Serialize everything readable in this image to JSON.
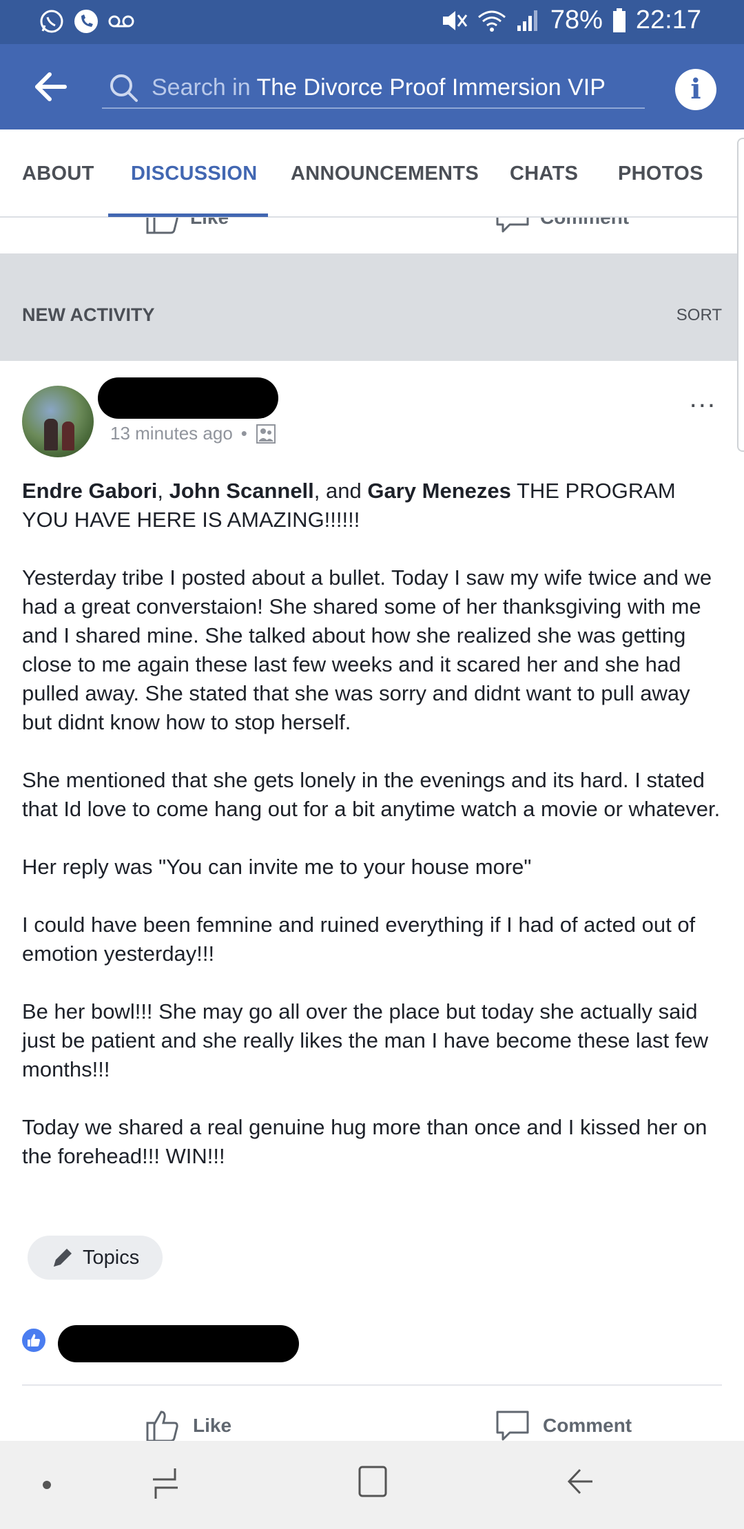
{
  "status_bar": {
    "battery": "78%",
    "time": "22:17"
  },
  "app_bar": {
    "search_prefix": "Search in",
    "group_name": "The Divorce Proof Immersion VIP"
  },
  "tabs": [
    {
      "label": "ABOUT"
    },
    {
      "label": "DISCUSSION"
    },
    {
      "label": "ANNOUNCEMENTS"
    },
    {
      "label": "CHATS"
    },
    {
      "label": "PHOTOS"
    }
  ],
  "peek": {
    "like_label": "Like",
    "comment_label": "Comment"
  },
  "section": {
    "title": "NEW ACTIVITY",
    "sort_label": "SORT"
  },
  "post": {
    "timestamp": "13 minutes ago",
    "separator": "•",
    "more": "...",
    "tag1": "Endre Gabori",
    "tag_sep1": ",",
    "tag2": "John Scannell",
    "tag_sep2": ", and",
    "tag3": "Gary Menezes",
    "intro": "THE PROGRAM YOU HAVE HERE IS AMAZING!!!!!!",
    "paragraphs": [
      "Yesterday tribe I posted about a bullet. Today I saw my wife twice and we had a great converstaion! She shared some of her thanksgiving with me and I shared mine. She talked about how she realized she was getting close to me again these last few weeks and it scared her and she had pulled away. She stated that she was sorry and didnt want to pull away but didnt know how to stop herself.",
      "She mentioned that she gets lonely in the evenings and its hard. I stated that Id love to come hang out for a bit anytime watch a movie or whatever.",
      "Her reply was \"You can invite me to your house more\"",
      "I could have been femnine and ruined everything if I had of acted out of emotion yesterday!!!",
      "Be her bowl!!! She may go all over the place but today she actually said just be patient and she really likes the man I have become these last few months!!!",
      "Today we shared a real genuine hug more than once and I kissed her on the forehead!!! WIN!!!"
    ],
    "topics_label": "Topics",
    "like_label": "Like",
    "comment_label": "Comment"
  }
}
